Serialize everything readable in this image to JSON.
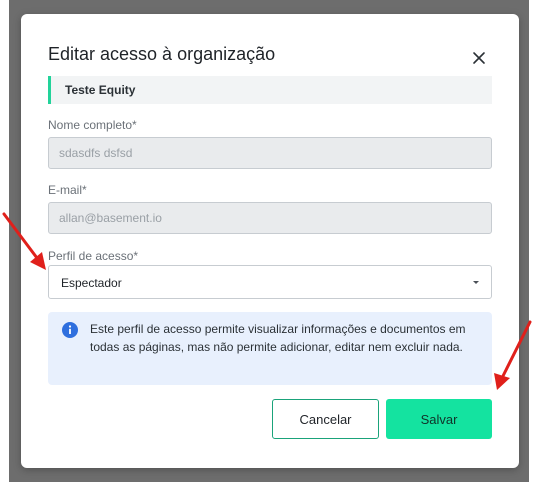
{
  "modal": {
    "title": "Editar acesso à organização",
    "organization_name": "Teste Equity",
    "close_icon": "close-icon"
  },
  "form": {
    "full_name_label": "Nome completo",
    "full_name_value": "sdasdfs dsfsd",
    "email_label": "E-mail",
    "email_value": "allan@basement.io",
    "profile_label": "Perfil de acesso",
    "profile_value": "Espectador",
    "required_mark": "*"
  },
  "info": {
    "icon": "info-icon",
    "text": "Este perfil de acesso permite visualizar informações e documentos em todas as páginas, mas não permite adicionar, editar nem excluir nada."
  },
  "buttons": {
    "cancel_label": "Cancelar",
    "save_label": "Salvar"
  },
  "colors": {
    "accent": "#14e3a0",
    "accent_border": "#22d39a",
    "info_bg": "#e8f0fd",
    "info_icon": "#2f6fde",
    "annotation_arrow": "#e0201b"
  }
}
